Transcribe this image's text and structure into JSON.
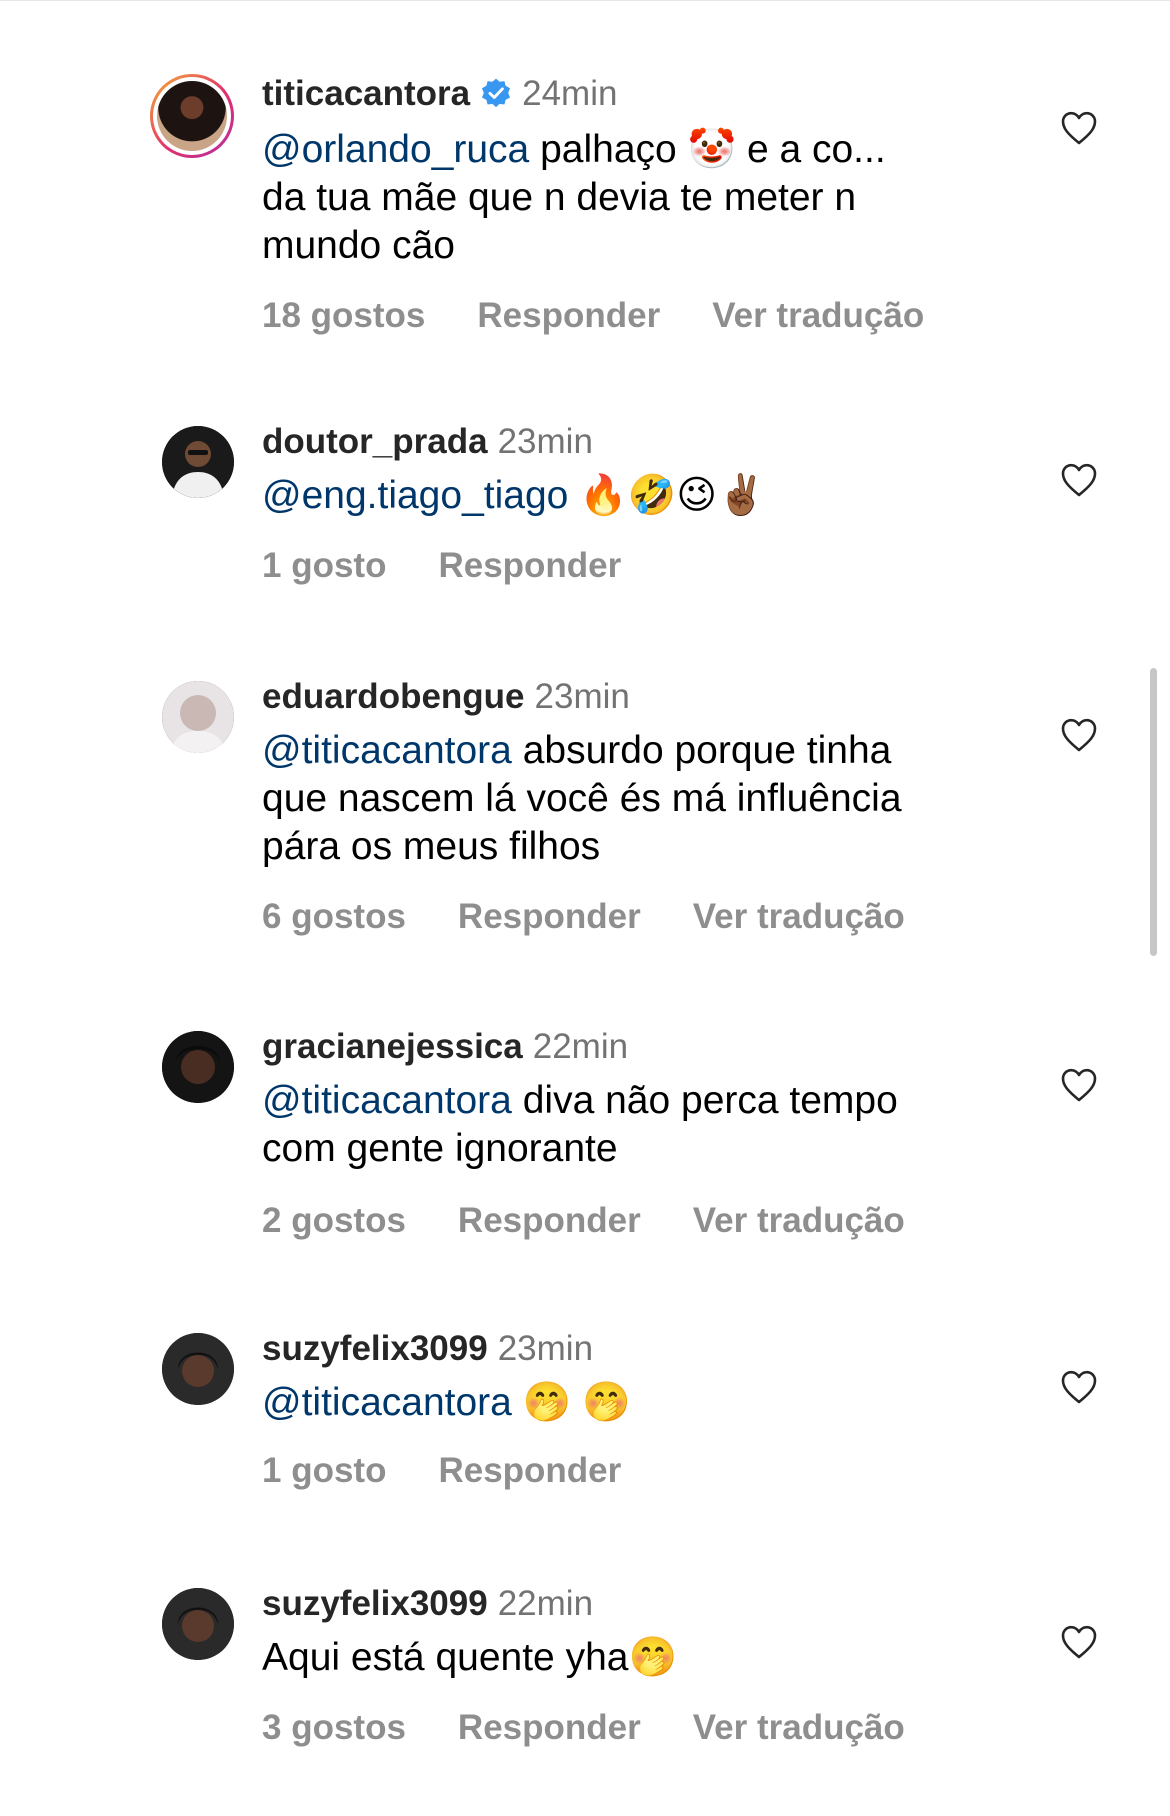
{
  "comments": [
    {
      "username": "titicacantora",
      "verified": true,
      "time": "24min",
      "mention": "@orlando_ruca",
      "text_lines": [
        "palhaço 🤡 e a co...",
        "da tua mãe que n devia te meter n",
        "mundo cão"
      ],
      "likes": "18 gostos",
      "reply": "Responder",
      "translate": "Ver tradução",
      "avatar_icon": "profile-photo-with-story-ring"
    },
    {
      "username": "doutor_prada",
      "verified": false,
      "time": "23min",
      "mention": "@eng.tiago_tiago",
      "text_lines": [
        "🔥🤣😉✌🏾"
      ],
      "likes": "1 gosto",
      "reply": "Responder",
      "translate": "",
      "avatar_icon": "profile-photo"
    },
    {
      "username": "eduardobengue",
      "verified": false,
      "time": "23min",
      "mention": "@titicacantora",
      "text_lines": [
        "absurdo porque  tinha",
        "que nascem lá você és má influência",
        "pára os meus filhos"
      ],
      "likes": "6 gostos",
      "reply": "Responder",
      "translate": "Ver tradução",
      "avatar_icon": "profile-photo"
    },
    {
      "username": "gracianejessica",
      "verified": false,
      "time": "22min",
      "mention": "@titicacantora",
      "text_lines": [
        "diva não perca tempo",
        "com gente ignorante"
      ],
      "likes": "2 gostos",
      "reply": "Responder",
      "translate": "Ver tradução",
      "avatar_icon": "profile-photo"
    },
    {
      "username": "suzyfelix3099",
      "verified": false,
      "time": "23min",
      "mention": "@titicacantora",
      "text_lines": [
        "🤭 🤭"
      ],
      "likes": "1 gosto",
      "reply": "Responder",
      "translate": "",
      "avatar_icon": "profile-photo"
    },
    {
      "username": "suzyfelix3099",
      "verified": false,
      "time": "22min",
      "mention": "",
      "text_lines": [
        "Aqui está quente yha🤭"
      ],
      "likes": "3 gostos",
      "reply": "Responder",
      "translate": "Ver tradução",
      "avatar_icon": "profile-photo"
    }
  ],
  "colors": {
    "mention": "#00376b",
    "meta": "#8e8e8e",
    "verified": "#3897f0"
  },
  "icons": {
    "like": "heart-outline-icon",
    "verified": "verified-badge-icon"
  }
}
